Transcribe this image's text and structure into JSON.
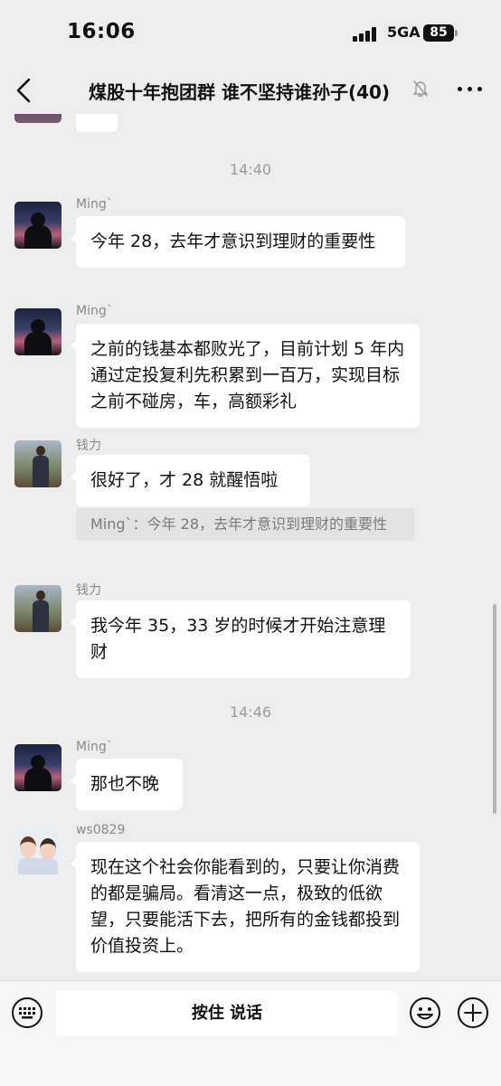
{
  "status_bar": {
    "time": "16:06",
    "network": "5GA",
    "battery": "85"
  },
  "nav": {
    "title": "煤股十年抱团群 谁不坚持谁孙子(40)"
  },
  "chat": {
    "time_separators": [
      "14:40",
      "14:46"
    ],
    "messages": [
      {
        "sender": "Ming`",
        "text": "今年 28，去年才意识到理财的重要性"
      },
      {
        "sender": "Ming`",
        "text": "之前的钱基本都败光了，目前计划 5 年内通过定投复利先积累到一百万，实现目标之前不碰房，车，高额彩礼"
      },
      {
        "sender": "钱力",
        "text": "很好了，才 28 就醒悟啦",
        "quote": "Ming`：今年 28，去年才意识到理财的重要性"
      },
      {
        "sender": "钱力",
        "text": "我今年 35，33 岁的时候才开始注意理财"
      },
      {
        "sender": "Ming`",
        "text": "那也不晚"
      },
      {
        "sender": "ws0829",
        "text": "现在这个社会你能看到的，只要让你消费的都是骗局。看清这一点，极致的低欲望，只要能活下去，把所有的金钱都投到价值投资上。"
      }
    ]
  },
  "input_bar": {
    "hold_to_talk": "按住 说话"
  },
  "icons": {
    "back": "chevron-left-icon",
    "mute": "bell-off-icon",
    "more": "more-dots-icon",
    "keyboard": "keyboard-icon",
    "emoji": "emoji-icon",
    "plus": "plus-circle-icon"
  },
  "colors": {
    "background": "#ededed",
    "bubble": "#ffffff",
    "quote": "#e3e3e3",
    "meta_text": "#9b9b9b"
  }
}
